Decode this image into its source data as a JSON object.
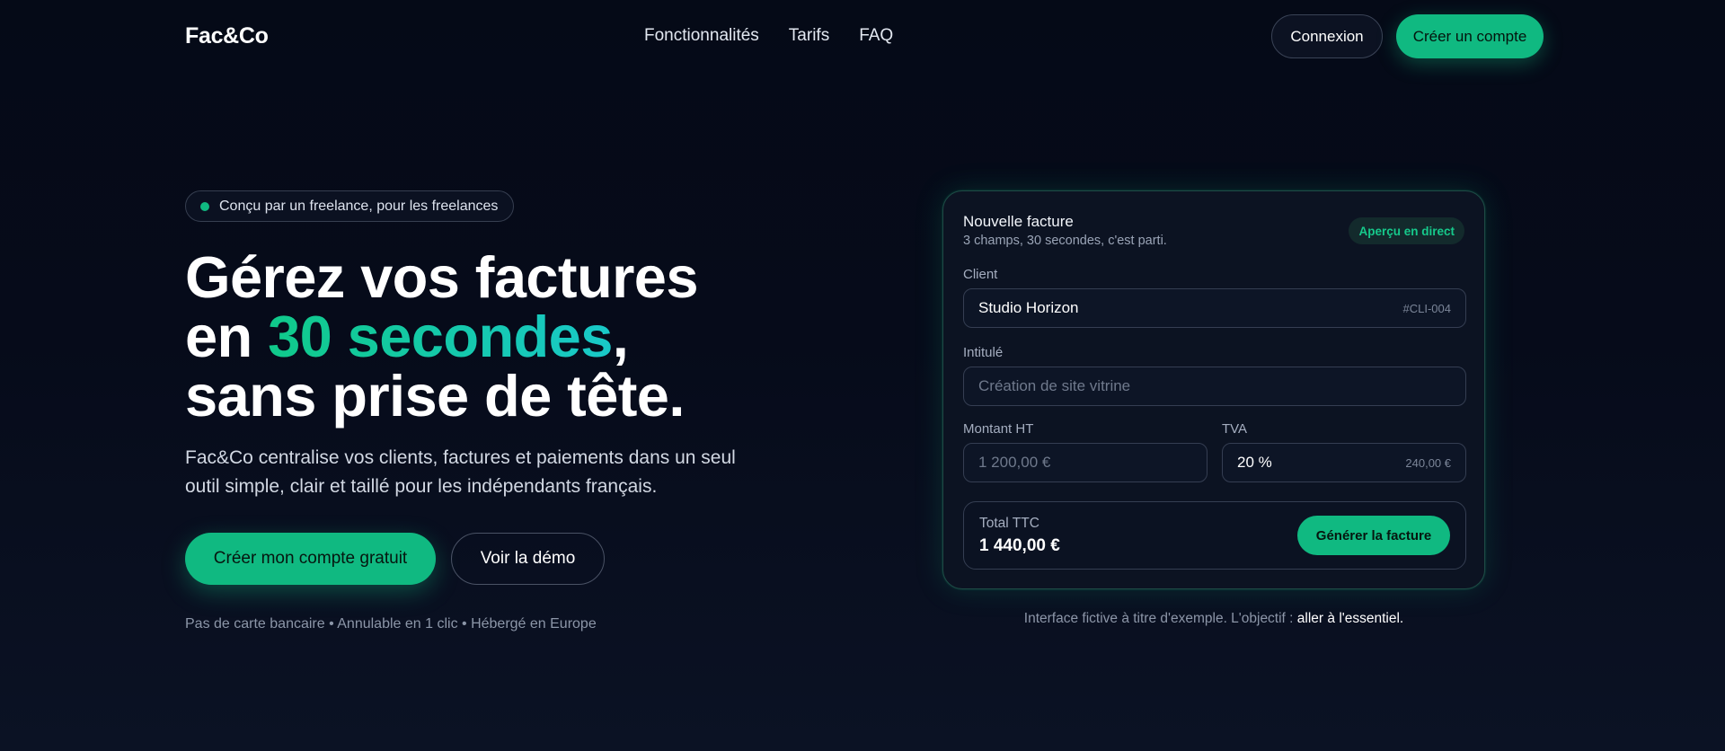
{
  "header": {
    "logo": "Fac&Co",
    "nav": [
      "Fonctionnalités",
      "Tarifs",
      "FAQ"
    ],
    "login_label": "Connexion",
    "signup_label": "Créer un compte"
  },
  "hero": {
    "badge": "Conçu par un freelance, pour les freelances",
    "headline_line1": "Gérez vos factures",
    "headline_line2_before": "en ",
    "headline_line2_accent": "30 secondes",
    "headline_line2_after": ",",
    "headline_line3": "sans prise de tête.",
    "subtitle": "Fac&Co centralise vos clients, factures et paiements dans un seul outil simple, clair et taillé pour les indépendants français.",
    "cta_primary": "Créer mon compte gratuit",
    "cta_secondary": "Voir la démo",
    "reassurance": "Pas de carte bancaire • Annulable en 1 clic • Hébergé en Europe"
  },
  "invoice": {
    "title": "Nouvelle facture",
    "subtitle": "3 champs, 30 secondes, c'est parti.",
    "live_badge": "Aperçu en direct",
    "client": {
      "label": "Client",
      "value": "Studio Horizon",
      "ref": "#CLI-004"
    },
    "intitule": {
      "label": "Intitulé",
      "placeholder": "Création de site vitrine"
    },
    "montant": {
      "label": "Montant HT",
      "placeholder": "1 200,00 €"
    },
    "tva": {
      "label": "TVA",
      "value": "20 %",
      "amount": "240,00 €"
    },
    "total": {
      "label": "Total TTC",
      "value": "1 440,00 €"
    },
    "generate_label": "Générer la facture"
  },
  "footnote": {
    "text": "Interface fictive à titre d'exemple. L'objectif : ",
    "emphasis": "aller à l'essentiel."
  },
  "colors": {
    "accent": "#10b981",
    "accent_teal": "#19c9c9",
    "background": "#060b1a"
  }
}
